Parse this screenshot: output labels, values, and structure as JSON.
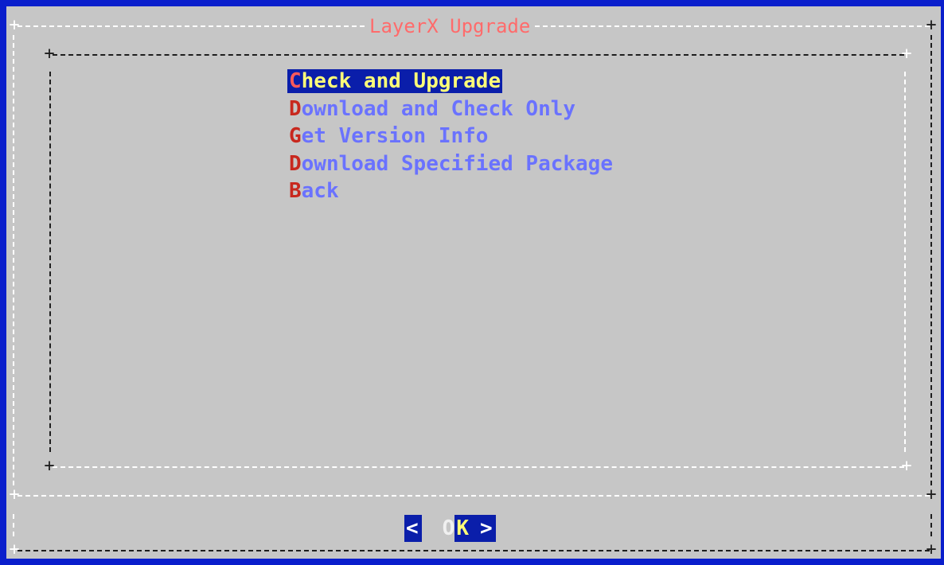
{
  "dialog": {
    "title": "LayerX Upgrade"
  },
  "menu": {
    "items": [
      {
        "hotkey": "C",
        "rest": "heck and Upgrade",
        "selected": true
      },
      {
        "hotkey": "D",
        "rest": "ownload and Check Only",
        "selected": false
      },
      {
        "hotkey": "G",
        "rest": "et Version Info",
        "selected": false
      },
      {
        "hotkey": "D",
        "rest": "ownload Specified Package",
        "selected": false
      },
      {
        "hotkey": "B",
        "rest": "ack",
        "selected": false
      }
    ]
  },
  "buttons": {
    "ok": {
      "left_bracket": "<",
      "first": "O",
      "rest": "K",
      "right_bracket": ">"
    }
  },
  "colors": {
    "background": "#0a1ecc",
    "dialog": "#c6c6c6",
    "title": "#ff6b6b",
    "hotkey": "#c8281e",
    "item": "#6a72ff",
    "selection": "#0a1eaa",
    "selected_text": "#ffff78"
  }
}
